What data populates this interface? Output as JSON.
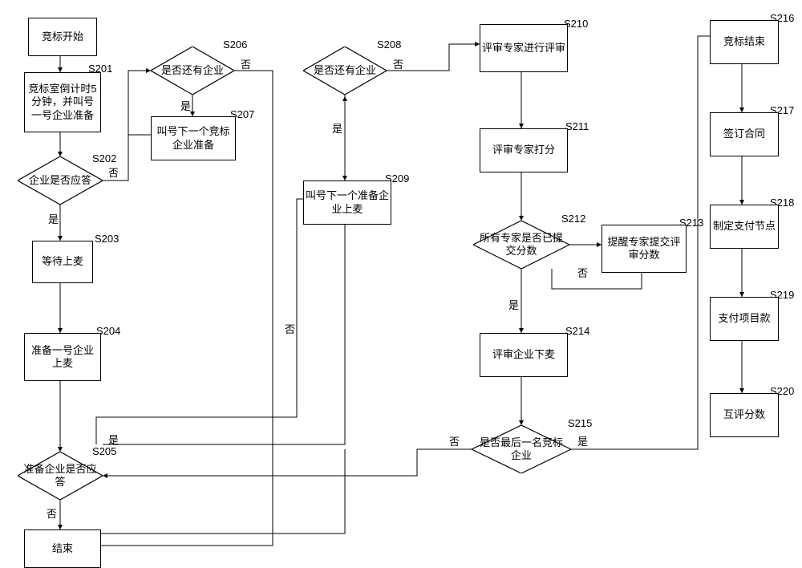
{
  "chart_data": {
    "type": "flowchart",
    "title": "",
    "nodes": [
      {
        "id": "start",
        "type": "process",
        "label": "竞标开始"
      },
      {
        "id": "S201",
        "type": "process",
        "label": "竞标室倒计时5分钟，并叫号一号企业准备",
        "tag": "S201"
      },
      {
        "id": "S202",
        "type": "decision",
        "label": "企业是否应答",
        "tag": "S202"
      },
      {
        "id": "S203",
        "type": "process",
        "label": "等待上麦",
        "tag": "S203"
      },
      {
        "id": "S204",
        "type": "process",
        "label": "准备一号企业上麦",
        "tag": "S204"
      },
      {
        "id": "S205",
        "type": "decision",
        "label": "准备企业是否应答",
        "tag": "S205"
      },
      {
        "id": "S206",
        "type": "decision",
        "label": "是否还有企业",
        "tag": "S206"
      },
      {
        "id": "S207",
        "type": "process",
        "label": "叫号下一个竞标企业准备",
        "tag": "S207"
      },
      {
        "id": "S208",
        "type": "decision",
        "label": "是否还有企业",
        "tag": "S208"
      },
      {
        "id": "S209",
        "type": "process",
        "label": "叫号下一个准备企业上麦",
        "tag": "S209"
      },
      {
        "id": "S210",
        "type": "process",
        "label": "评审专家进行评审",
        "tag": "S210"
      },
      {
        "id": "S211",
        "type": "process",
        "label": "评审专家打分",
        "tag": "S211"
      },
      {
        "id": "S212",
        "type": "decision",
        "label": "所有专家是否已提交分数",
        "tag": "S212"
      },
      {
        "id": "S213",
        "type": "process",
        "label": "提醒专家提交评审分数",
        "tag": "S213"
      },
      {
        "id": "S214",
        "type": "process",
        "label": "评审企业下麦",
        "tag": "S214"
      },
      {
        "id": "S215",
        "type": "decision",
        "label": "是否最后一名竞标企业",
        "tag": "S215"
      },
      {
        "id": "S216",
        "type": "process",
        "label": "竞标结束",
        "tag": "S216"
      },
      {
        "id": "S217",
        "type": "process",
        "label": "签订合同",
        "tag": "S217"
      },
      {
        "id": "S218",
        "type": "process",
        "label": "制定支付节点",
        "tag": "S218"
      },
      {
        "id": "S219",
        "type": "process",
        "label": "支付项目款",
        "tag": "S219"
      },
      {
        "id": "S220",
        "type": "process",
        "label": "互评分数",
        "tag": "S220"
      },
      {
        "id": "end",
        "type": "terminator",
        "label": "结束"
      }
    ],
    "edges": [
      {
        "from": "start",
        "to": "S201"
      },
      {
        "from": "S201",
        "to": "S202"
      },
      {
        "from": "S202",
        "to": "S203",
        "label": "是"
      },
      {
        "from": "S202",
        "to": "S206",
        "label": "否"
      },
      {
        "from": "S203",
        "to": "S204"
      },
      {
        "from": "S204",
        "to": "S205"
      },
      {
        "from": "S205",
        "to": "S208",
        "label": "是"
      },
      {
        "from": "S205",
        "to": "end",
        "label": "否"
      },
      {
        "from": "S206",
        "to": "S207",
        "label": "是"
      },
      {
        "from": "S206",
        "to": "end",
        "label": "否"
      },
      {
        "from": "S207",
        "to": "S202"
      },
      {
        "from": "S208",
        "to": "S209",
        "label": "是"
      },
      {
        "from": "S208",
        "to": "S210",
        "label": "否"
      },
      {
        "from": "S209",
        "to": "S205"
      },
      {
        "from": "S210",
        "to": "S211"
      },
      {
        "from": "S211",
        "to": "S212"
      },
      {
        "from": "S212",
        "to": "S214",
        "label": "是"
      },
      {
        "from": "S212",
        "to": "S213",
        "label": "否"
      },
      {
        "from": "S213",
        "to": "S212"
      },
      {
        "from": "S214",
        "to": "S215"
      },
      {
        "from": "S215",
        "to": "S216",
        "label": "是"
      },
      {
        "from": "S215",
        "to": "S205",
        "label": "否"
      },
      {
        "from": "S216",
        "to": "S217"
      },
      {
        "from": "S217",
        "to": "S218"
      },
      {
        "from": "S218",
        "to": "S219"
      },
      {
        "from": "S219",
        "to": "S220"
      }
    ]
  },
  "labels": {
    "yes": "是",
    "no": "否"
  }
}
